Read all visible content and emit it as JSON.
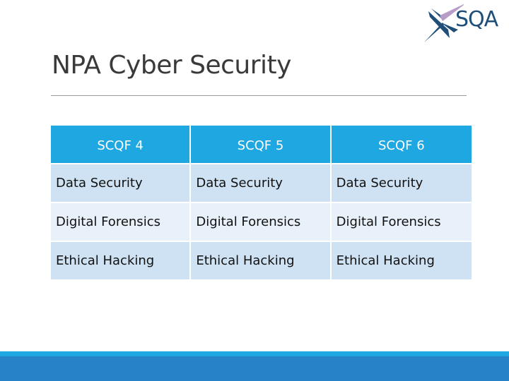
{
  "logo": {
    "text": "SQA",
    "icon": "sqa-saltire-icon"
  },
  "title": "NPA Cyber Security",
  "table": {
    "headers": [
      "SCQF 4",
      "SCQF 5",
      "SCQF 6"
    ],
    "rows": [
      [
        "Data Security",
        "Data Security",
        "Data Security"
      ],
      [
        "Digital Forensics",
        "Digital Forensics",
        "Digital Forensics"
      ],
      [
        "Ethical Hacking",
        "Ethical Hacking",
        "Ethical Hacking"
      ]
    ]
  },
  "colors": {
    "header_bg": "#1ea7e1",
    "row_dark": "#cfe2f3",
    "row_light": "#e8f1fa",
    "footer": "#2782c6",
    "title": "#3a3a3a"
  }
}
